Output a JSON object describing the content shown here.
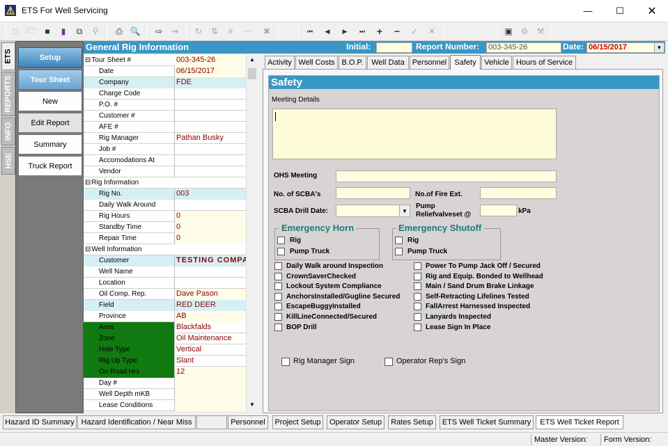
{
  "window": {
    "title": "ETS For Well Servicing"
  },
  "side_tabs": [
    "ETS",
    "REPORTS",
    "INFO",
    "HSE"
  ],
  "nav": [
    "Setup",
    "Tour Sheet",
    "New",
    "Edit Report",
    "Summary",
    "Truck Report"
  ],
  "header": {
    "title": "General Rig Information",
    "initial_label": "Initial:",
    "initial_value": "",
    "report_label": "Report Number:",
    "report_value": "003-345-26",
    "date_label": "Date:",
    "date_value": "06/15/2017"
  },
  "grid": {
    "rows": [
      {
        "k": "Tour Sheet #",
        "v": "003-345-26",
        "sec": true
      },
      {
        "k": "Date",
        "v": "06/15/2017"
      },
      {
        "k": "Company",
        "v": "FDE"
      },
      {
        "k": "Charge Code",
        "v": ""
      },
      {
        "k": "P.O. #",
        "v": ""
      },
      {
        "k": "Customer #",
        "v": ""
      },
      {
        "k": "AFE #",
        "v": ""
      },
      {
        "k": "Rig Manager",
        "v": "Pathan Busky"
      },
      {
        "k": "Job #",
        "v": ""
      },
      {
        "k": "Accomodations At",
        "v": ""
      },
      {
        "k": "Vendor",
        "v": ""
      },
      {
        "k": "Rig Information",
        "v": "",
        "sec": true
      },
      {
        "k": "Rig No.",
        "v": "003"
      },
      {
        "k": "Daily Walk Around",
        "v": ""
      },
      {
        "k": "Rig Hours",
        "v": "0"
      },
      {
        "k": "Standby Time",
        "v": "0"
      },
      {
        "k": "Repair Time",
        "v": "0"
      },
      {
        "k": "Well Information",
        "v": "",
        "sec": true
      },
      {
        "k": "Customer",
        "v": "TESTING COMPANY"
      },
      {
        "k": "Well Name",
        "v": ""
      },
      {
        "k": "Location",
        "v": ""
      },
      {
        "k": "Oil Comp. Rep.",
        "v": "Dave Pason"
      },
      {
        "k": "Field",
        "v": "RED DEER"
      },
      {
        "k": "Province",
        "v": "AB"
      },
      {
        "k": "Area",
        "v": "Blackfalds"
      },
      {
        "k": "Zone",
        "v": "Oil Maintenance"
      },
      {
        "k": "Hole Type",
        "v": "Vertical"
      },
      {
        "k": "Rig Up Type",
        "v": "Slant"
      },
      {
        "k": "On Road Hrs",
        "v": "12"
      },
      {
        "k": "Day #",
        "v": ""
      },
      {
        "k": "Well Depth mKB",
        "v": ""
      },
      {
        "k": "Lease Conditions",
        "v": ""
      }
    ]
  },
  "tabs": [
    "Activity",
    "Well Costs",
    "B.O.P.",
    "Well Data",
    "Personnel",
    "Safety",
    "Vehicle",
    "Hours of Service"
  ],
  "safety": {
    "title": "Safety",
    "meeting_label": "Meeting Details",
    "ohs_label": "OHS Meeting",
    "scba_label": "No. of SCBA's",
    "fire_label": "No.of Fire Ext.",
    "drill_label": "SCBA Drill Date:",
    "pump_label1": "Pump",
    "pump_label2": "Reliefvalveset @",
    "kpa": "kPa",
    "horn_title": "Emergency Horn",
    "shutoff_title": "Emergency Shutoff",
    "rig": "Rig",
    "pump_truck": "Pump Truck",
    "checks_left": [
      "Daily Walk around Inspection",
      "CrownSaverChecked",
      "Lockout System Compliance",
      "AnchorsInstalled/Gugline Secured",
      "EscapeBuggyInstalled",
      "KillLineConnected/Secured",
      "BOP Drill"
    ],
    "checks_right": [
      "Power To Pump Jack Off / Secured",
      "Rig and Equip. Bonded to Wellhead",
      "Main / Sand Drum Brake Linkage",
      "Self-Retracting Lifelines Tested",
      "FallArrest Harnessed Inspected",
      "Lanyards Inspected",
      "Lease Sign In Place"
    ],
    "rig_sign": "Rig Manager Sign",
    "op_sign": "Operator Rep's Sign"
  },
  "bottom_tabs": [
    "Hazard ID Summary",
    "Hazard Identification / Near Miss",
    "",
    "Personnel",
    "Project Setup",
    "Operator Setup",
    "Rates Setup",
    "ETS Well Ticket Summary",
    "ETS Well Ticket Report"
  ],
  "status": {
    "master": "Master Version:",
    "form": "Form Version:"
  }
}
